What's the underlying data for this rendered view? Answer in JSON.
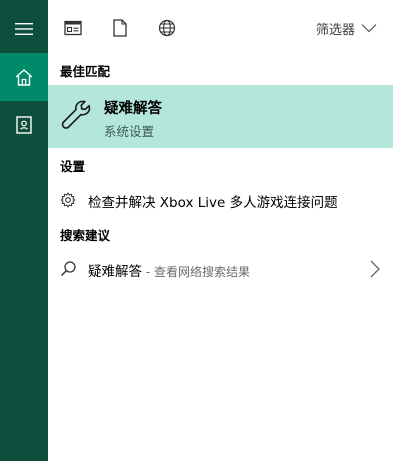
{
  "rail": {
    "items": [
      {
        "name": "hamburger-menu",
        "icon": "hamburger-icon"
      },
      {
        "name": "home",
        "icon": "home-icon",
        "active": true
      },
      {
        "name": "notebook",
        "icon": "notebook-icon"
      }
    ]
  },
  "toolbar": {
    "icons": [
      "apps-icon",
      "documents-icon",
      "web-globe-icon"
    ],
    "filter_label": "筛选器"
  },
  "sections": {
    "best_match": "最佳匹配",
    "settings": "设置",
    "suggestions": "搜索建议"
  },
  "best_match": {
    "name": "疑难解答",
    "subtitle": "系统设置"
  },
  "settings_result": {
    "label": "检查并解决 Xbox Live 多人游戏连接问题"
  },
  "web_suggestion": {
    "query": "疑难解答",
    "suffix": " - 查看网络搜索结果"
  },
  "colors": {
    "rail_bg": "#0d4e3d",
    "rail_active": "#008a6a",
    "highlight": "#b5e6dc"
  }
}
